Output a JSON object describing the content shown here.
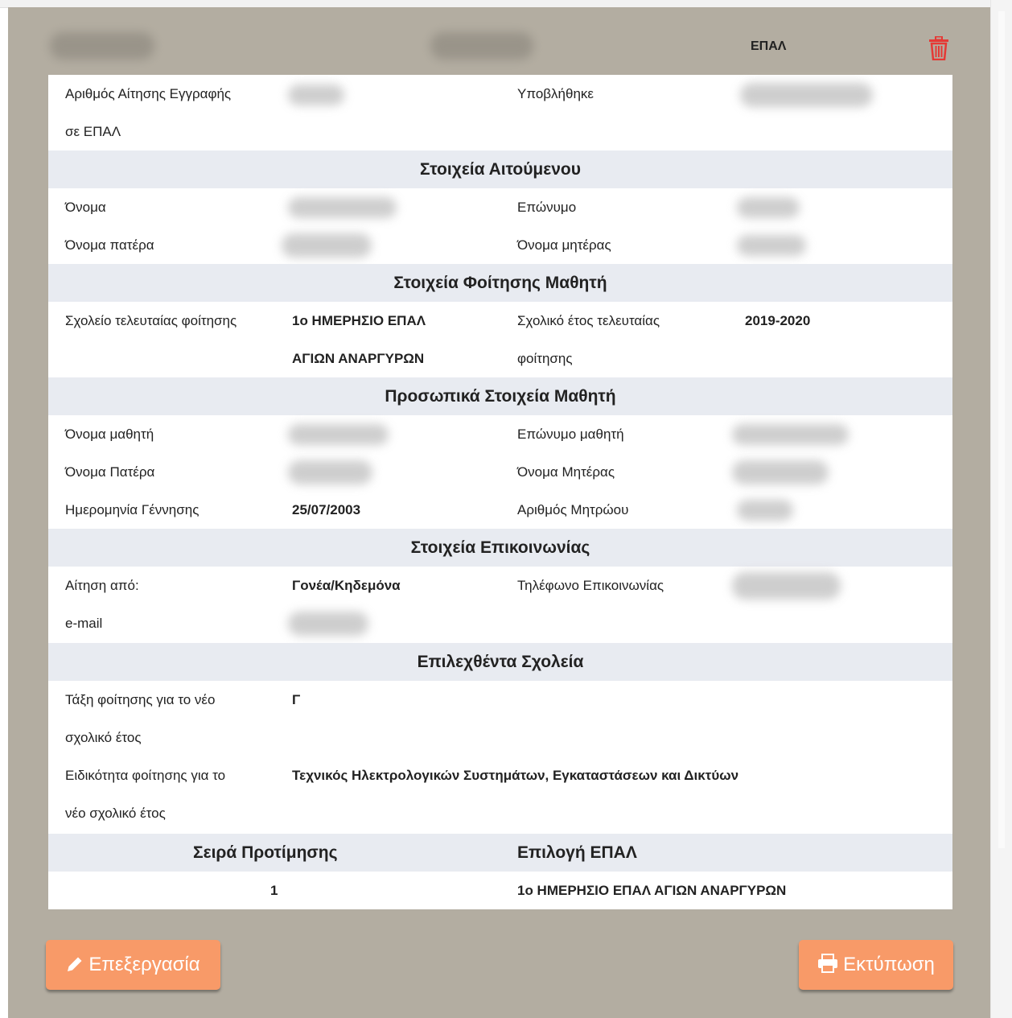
{
  "header": {
    "school_type": "ΕΠΑΛ"
  },
  "application": {
    "number_label": "Αριθμός Αίτησης Εγγραφής",
    "number_label2": "σε ΕΠΑΛ",
    "submitted_label": "Υποβλήθηκε"
  },
  "sections": {
    "applicant": "Στοιχεία Αιτούμενου",
    "attendance": "Στοιχεία Φοίτησης Μαθητή",
    "personal": "Προσωπικά Στοιχεία Μαθητή",
    "contact": "Στοιχεία Επικοινωνίας",
    "schools": "Επιλεχθέντα Σχολεία"
  },
  "applicant": {
    "first_name_label": "Όνομα",
    "last_name_label": "Επώνυμο",
    "father_label": "Όνομα πατέρα",
    "mother_label": "Όνομα μητέρας"
  },
  "attendance": {
    "last_school_label": "Σχολείο τελευταίας φοίτησης",
    "last_school_value_1": "1ο ΗΜΕΡΗΣΙΟ ΕΠΑΛ",
    "last_school_value_2": "ΑΓΙΩΝ ΑΝΑΡΓΥΡΩΝ",
    "last_year_label_1": "Σχολικό έτος τελευταίας",
    "last_year_label_2": "φοίτησης",
    "last_year_value": "2019-2020"
  },
  "personal": {
    "student_name_label": "Όνομα μαθητή",
    "student_surname_label": "Επώνυμο μαθητή",
    "father_label": "Όνομα Πατέρα",
    "mother_label": "Όνομα Μητέρας",
    "birth_label": "Ημερομηνία Γέννησης",
    "birth_value": "25/07/2003",
    "registry_label": "Αριθμός Μητρώου"
  },
  "contact": {
    "from_label": "Αίτηση από:",
    "from_value": "Γονέα/Κηδεμόνα",
    "phone_label": "Τηλέφωνο Επικοινωνίας",
    "email_label": "e-mail"
  },
  "schools": {
    "class_label_1": "Τάξη φοίτησης για το νέο",
    "class_label_2": "σχολικό έτος",
    "class_value": "Γ",
    "specialty_label_1": "Ειδικότητα φοίτησης για το",
    "specialty_label_2": "νέο σχολικό έτος",
    "specialty_value": "Τεχνικός Ηλεκτρολογικών Συστημάτων, Εγκαταστάσεων και Δικτύων",
    "pref_header": "Σειρά Προτίμησης",
    "choice_header": "Επιλογή ΕΠΑΛ",
    "pref_value": "1",
    "choice_value": "1ο ΗΜΕΡΗΣΙΟ ΕΠΑΛ ΑΓΙΩΝ ΑΝΑΡΓΥΡΩΝ"
  },
  "buttons": {
    "edit": "Επεξεργασία",
    "print": "Εκτύπωση"
  },
  "colors": {
    "panel": "#b3ada1",
    "button": "#f89a68",
    "section": "#e8ebf1",
    "trash": "#e53935"
  },
  "icons": {
    "delete": "trash-icon",
    "edit": "pencil-icon",
    "print": "printer-icon"
  }
}
